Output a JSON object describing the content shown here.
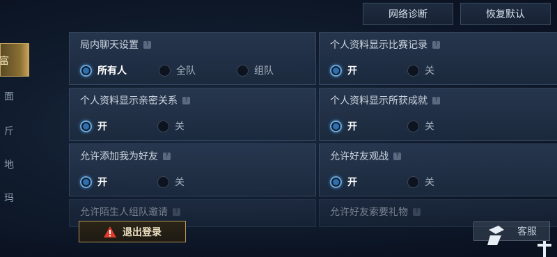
{
  "header": {
    "network_diag": "网络诊断",
    "restore_default": "恢复默认"
  },
  "sidebar": {
    "tabs": [
      {
        "label": "富"
      },
      {
        "label": "面"
      },
      {
        "label": "斤"
      },
      {
        "label": "地"
      },
      {
        "label": "玛"
      }
    ]
  },
  "settings": {
    "chat": {
      "title": "局内聊天设置",
      "options": [
        "所有人",
        "全队",
        "组队"
      ],
      "selected": "所有人"
    },
    "show_match_records": {
      "title": "个人资料显示比赛记录",
      "options": [
        "开",
        "关"
      ],
      "selected": "开"
    },
    "show_intimacy": {
      "title": "个人资料显示亲密关系",
      "options": [
        "开",
        "关"
      ],
      "selected": "开"
    },
    "show_achievements": {
      "title": "个人资料显示所获成就",
      "options": [
        "开",
        "关"
      ],
      "selected": "开"
    },
    "allow_friend_add": {
      "title": "允许添加我为好友",
      "options": [
        "开",
        "关"
      ],
      "selected": "开"
    },
    "allow_spectate": {
      "title": "允许好友观战",
      "options": [
        "开",
        "关"
      ],
      "selected": "开"
    },
    "allow_stranger_invite": {
      "title": "允许陌生人组队邀请"
    },
    "allow_gift_request": {
      "title": "允许好友索要礼物"
    }
  },
  "footer": {
    "logout": "退出登录",
    "service": "客服"
  },
  "colors": {
    "accent_gold": "#c8a65f",
    "radio_on": "#6aa6d6",
    "warn_red": "#e23b2e"
  }
}
